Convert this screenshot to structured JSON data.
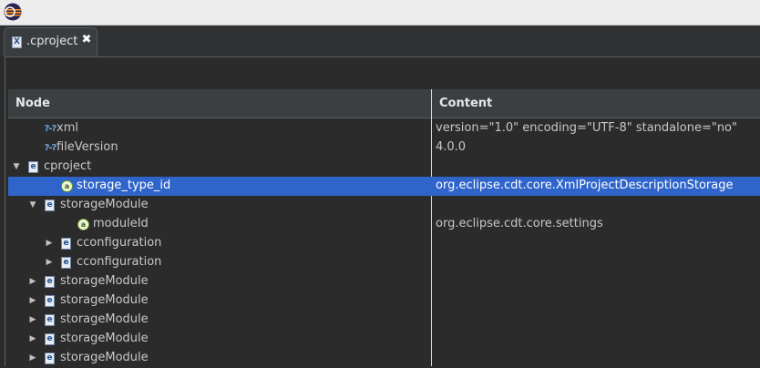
{
  "editor": {
    "tab_label": ".cproject",
    "tab_icon": "X",
    "close_glyph": "✖"
  },
  "columns": {
    "node": "Node",
    "content": "Content"
  },
  "rows": [
    {
      "node": "xml",
      "content": "version=\"1.0\" encoding=\"UTF-8\" standalone=\"no\"",
      "icon": "processing-instruction-icon",
      "icon_glyph": "?-?"
    },
    {
      "node": "fileVersion",
      "content": "4.0.0",
      "icon": "processing-instruction-icon",
      "icon_glyph": "?-?"
    },
    {
      "node": "cproject",
      "content": "",
      "icon": "element-icon",
      "icon_glyph": "e",
      "expander": "▼"
    },
    {
      "node": "storage_type_id",
      "content": "org.eclipse.cdt.core.XmlProjectDescriptionStorage",
      "icon": "attribute-icon",
      "icon_glyph": "a"
    },
    {
      "node": "storageModule",
      "content": "",
      "icon": "element-icon",
      "icon_glyph": "e",
      "expander": "▼"
    },
    {
      "node": "moduleId",
      "content": "org.eclipse.cdt.core.settings",
      "icon": "attribute-icon",
      "icon_glyph": "a"
    },
    {
      "node": "cconfiguration",
      "content": "",
      "icon": "element-icon",
      "icon_glyph": "e",
      "expander": "▶"
    },
    {
      "node": "cconfiguration",
      "content": "",
      "icon": "element-icon",
      "icon_glyph": "e",
      "expander": "▶"
    },
    {
      "node": "storageModule",
      "content": "",
      "icon": "element-icon",
      "icon_glyph": "e",
      "expander": "▶"
    },
    {
      "node": "storageModule",
      "content": "",
      "icon": "element-icon",
      "icon_glyph": "e",
      "expander": "▶"
    },
    {
      "node": "storageModule",
      "content": "",
      "icon": "element-icon",
      "icon_glyph": "e",
      "expander": "▶"
    },
    {
      "node": "storageModule",
      "content": "",
      "icon": "element-icon",
      "icon_glyph": "e",
      "expander": "▶"
    },
    {
      "node": "storageModule",
      "content": "",
      "icon": "element-icon",
      "icon_glyph": "e",
      "expander": "▶"
    }
  ],
  "colors": {
    "selection": "#2f65ca",
    "background": "#2b2b2b",
    "header": "#3c3f41",
    "text": "#c8c8c8"
  }
}
